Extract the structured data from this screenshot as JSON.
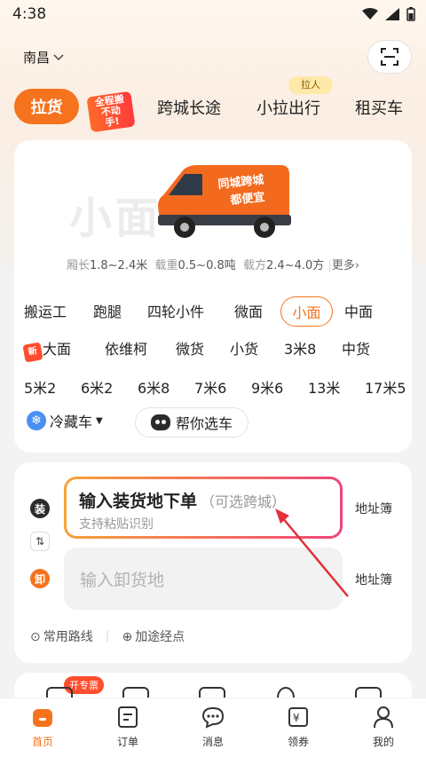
{
  "status_bar": {
    "time": "4:38"
  },
  "header": {
    "city": "南昌",
    "scan_icon": "scan-icon"
  },
  "tabs": {
    "active": "拉货",
    "badge": "全程搬 不动手!",
    "items": [
      "跨城长途",
      "小拉出行",
      "租买车"
    ],
    "small_tag": "拉人"
  },
  "vehicle": {
    "big_word": "小面",
    "van_text_1": "同城跨城",
    "van_text_2": "都便宜",
    "specs": {
      "len_label": "厢长",
      "len_value": "1.8~2.4米",
      "load_label": "载重",
      "load_value": "0.5~0.8吨",
      "vol_label": "载方",
      "vol_value": "2.4~4.0方",
      "more": "更多"
    },
    "row1": [
      "搬运工",
      "跑腿",
      "四轮小件",
      "微面",
      "小面",
      "中面"
    ],
    "row2": [
      "大面",
      "依维柯",
      "微货",
      "小货",
      "3米8",
      "中货"
    ],
    "row2_badge": "新",
    "row3": [
      "5米2",
      "6米2",
      "6米8",
      "7米6",
      "9米6",
      "13米",
      "17米5"
    ],
    "cold": "冷藏车",
    "help": "帮你选车"
  },
  "address": {
    "load_dot": "装",
    "unload_dot": "卸",
    "load_title": "输入装货地下单",
    "load_hint": "（可选跨城）",
    "load_sub": "支持粘贴识别",
    "unload_placeholder": "输入卸货地",
    "book": "地址簿",
    "link1": "常用路线",
    "link2": "加途经点"
  },
  "peek": {
    "badge": "开专票"
  },
  "nav": [
    {
      "label": "首页",
      "icon": "home-icon"
    },
    {
      "label": "订单",
      "icon": "order-icon"
    },
    {
      "label": "消息",
      "icon": "message-icon"
    },
    {
      "label": "领券",
      "icon": "coupon-icon"
    },
    {
      "label": "我的",
      "icon": "profile-icon"
    }
  ],
  "colors": {
    "accent": "#f6731e",
    "arrow": "#e0303a"
  }
}
